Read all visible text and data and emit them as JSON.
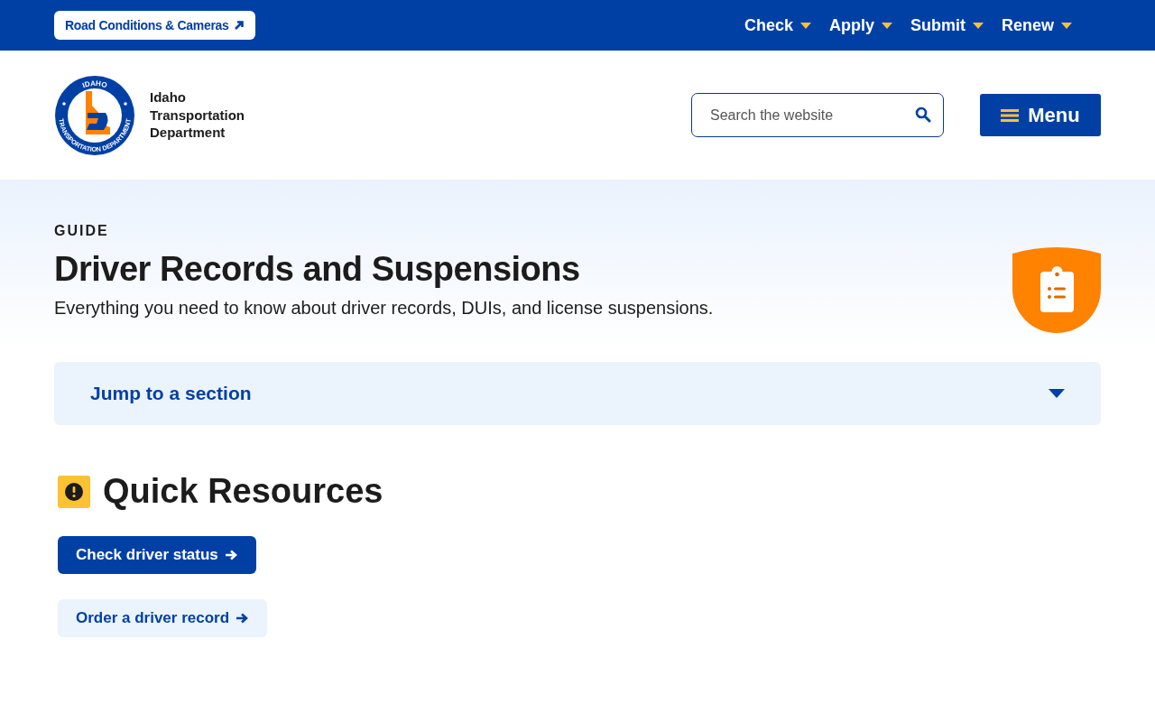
{
  "utility_bar": {
    "link": "Road Conditions & Cameras",
    "nav": [
      {
        "label": "Check"
      },
      {
        "label": "Apply"
      },
      {
        "label": "Submit"
      },
      {
        "label": "Renew"
      }
    ]
  },
  "header": {
    "logo_text": {
      "top": "IDAHO",
      "bottom": "TRANSPORTATION DEPARTMENT"
    },
    "name_lines": [
      "Idaho",
      "Transportation",
      "Department"
    ],
    "search": {
      "placeholder": "Search the website"
    },
    "menu_button": "Menu"
  },
  "hero": {
    "eyebrow": "GUIDE",
    "title": "Driver Records and Suspensions",
    "subtitle": "Everything you need to know about driver records, DUIs, and license suspensions."
  },
  "jump": {
    "label": "Jump to a section",
    "expanded": false
  },
  "quick_resources": {
    "title": "Quick Resources",
    "buttons": [
      {
        "label": "Check driver status",
        "kind": "primary"
      },
      {
        "label": "Order a driver record",
        "kind": "secondary"
      }
    ]
  }
}
